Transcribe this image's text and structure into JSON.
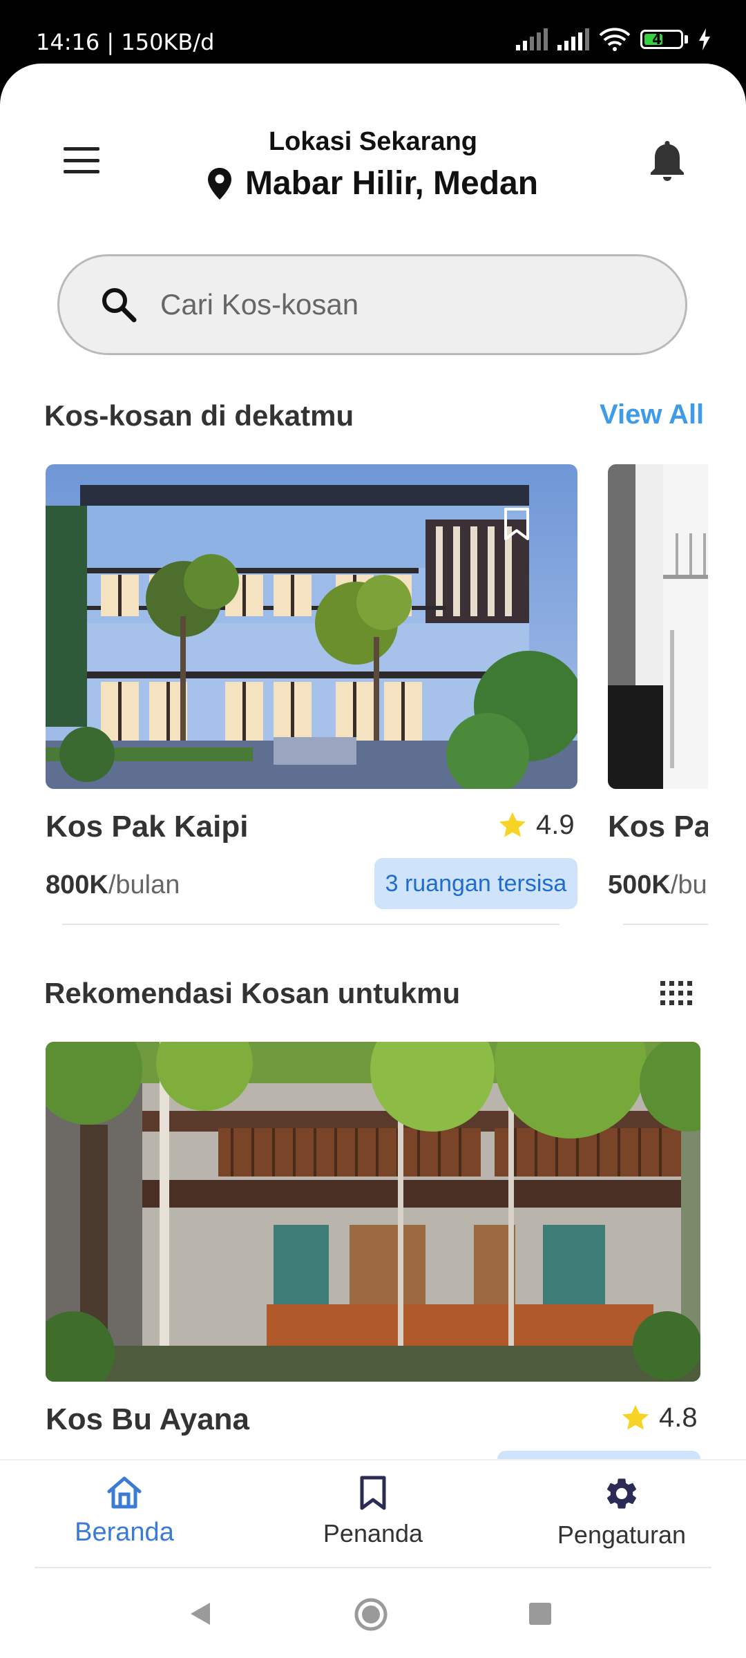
{
  "status_bar": {
    "time_speed": "14:16 | 150KB/d",
    "battery_level": "45",
    "icons": [
      "signal-icon",
      "signal-icon",
      "wifi-icon",
      "battery-icon",
      "charging-icon"
    ]
  },
  "header": {
    "caption": "Lokasi Sekarang",
    "location": "Mabar Hilir, Medan",
    "icons": [
      "menu-icon",
      "location-pin-icon",
      "bell-icon"
    ]
  },
  "search": {
    "placeholder": "Cari Kos-kosan",
    "icon": "search-icon"
  },
  "nearby": {
    "title": "Kos-kosan di dekatmu",
    "view_all": "View All",
    "cards": [
      {
        "name": "Kos Pak Kaipi",
        "rating": "4.9",
        "price": "800K",
        "unit": "/bulan",
        "badge": "3 ruangan tersisa"
      },
      {
        "name": "Kos Pak",
        "price": "500K",
        "unit": "/bu"
      }
    ]
  },
  "recommend": {
    "title": "Rekomendasi Kosan untukmu",
    "grid_icon": "grid-icon",
    "cards": [
      {
        "name": "Kos Bu Ayana",
        "rating": "4.8"
      }
    ]
  },
  "bottom_nav": {
    "items": [
      {
        "label": "Beranda",
        "icon": "home-icon",
        "active": true
      },
      {
        "label": "Penanda",
        "icon": "bookmark-icon",
        "active": false
      },
      {
        "label": "Pengaturan",
        "icon": "gear-icon",
        "active": false
      }
    ]
  },
  "colors": {
    "accent": "#3d9be9",
    "nav_active": "#3a7bd5",
    "badge_bg": "#cfe3fb",
    "star": "#f6d324"
  }
}
